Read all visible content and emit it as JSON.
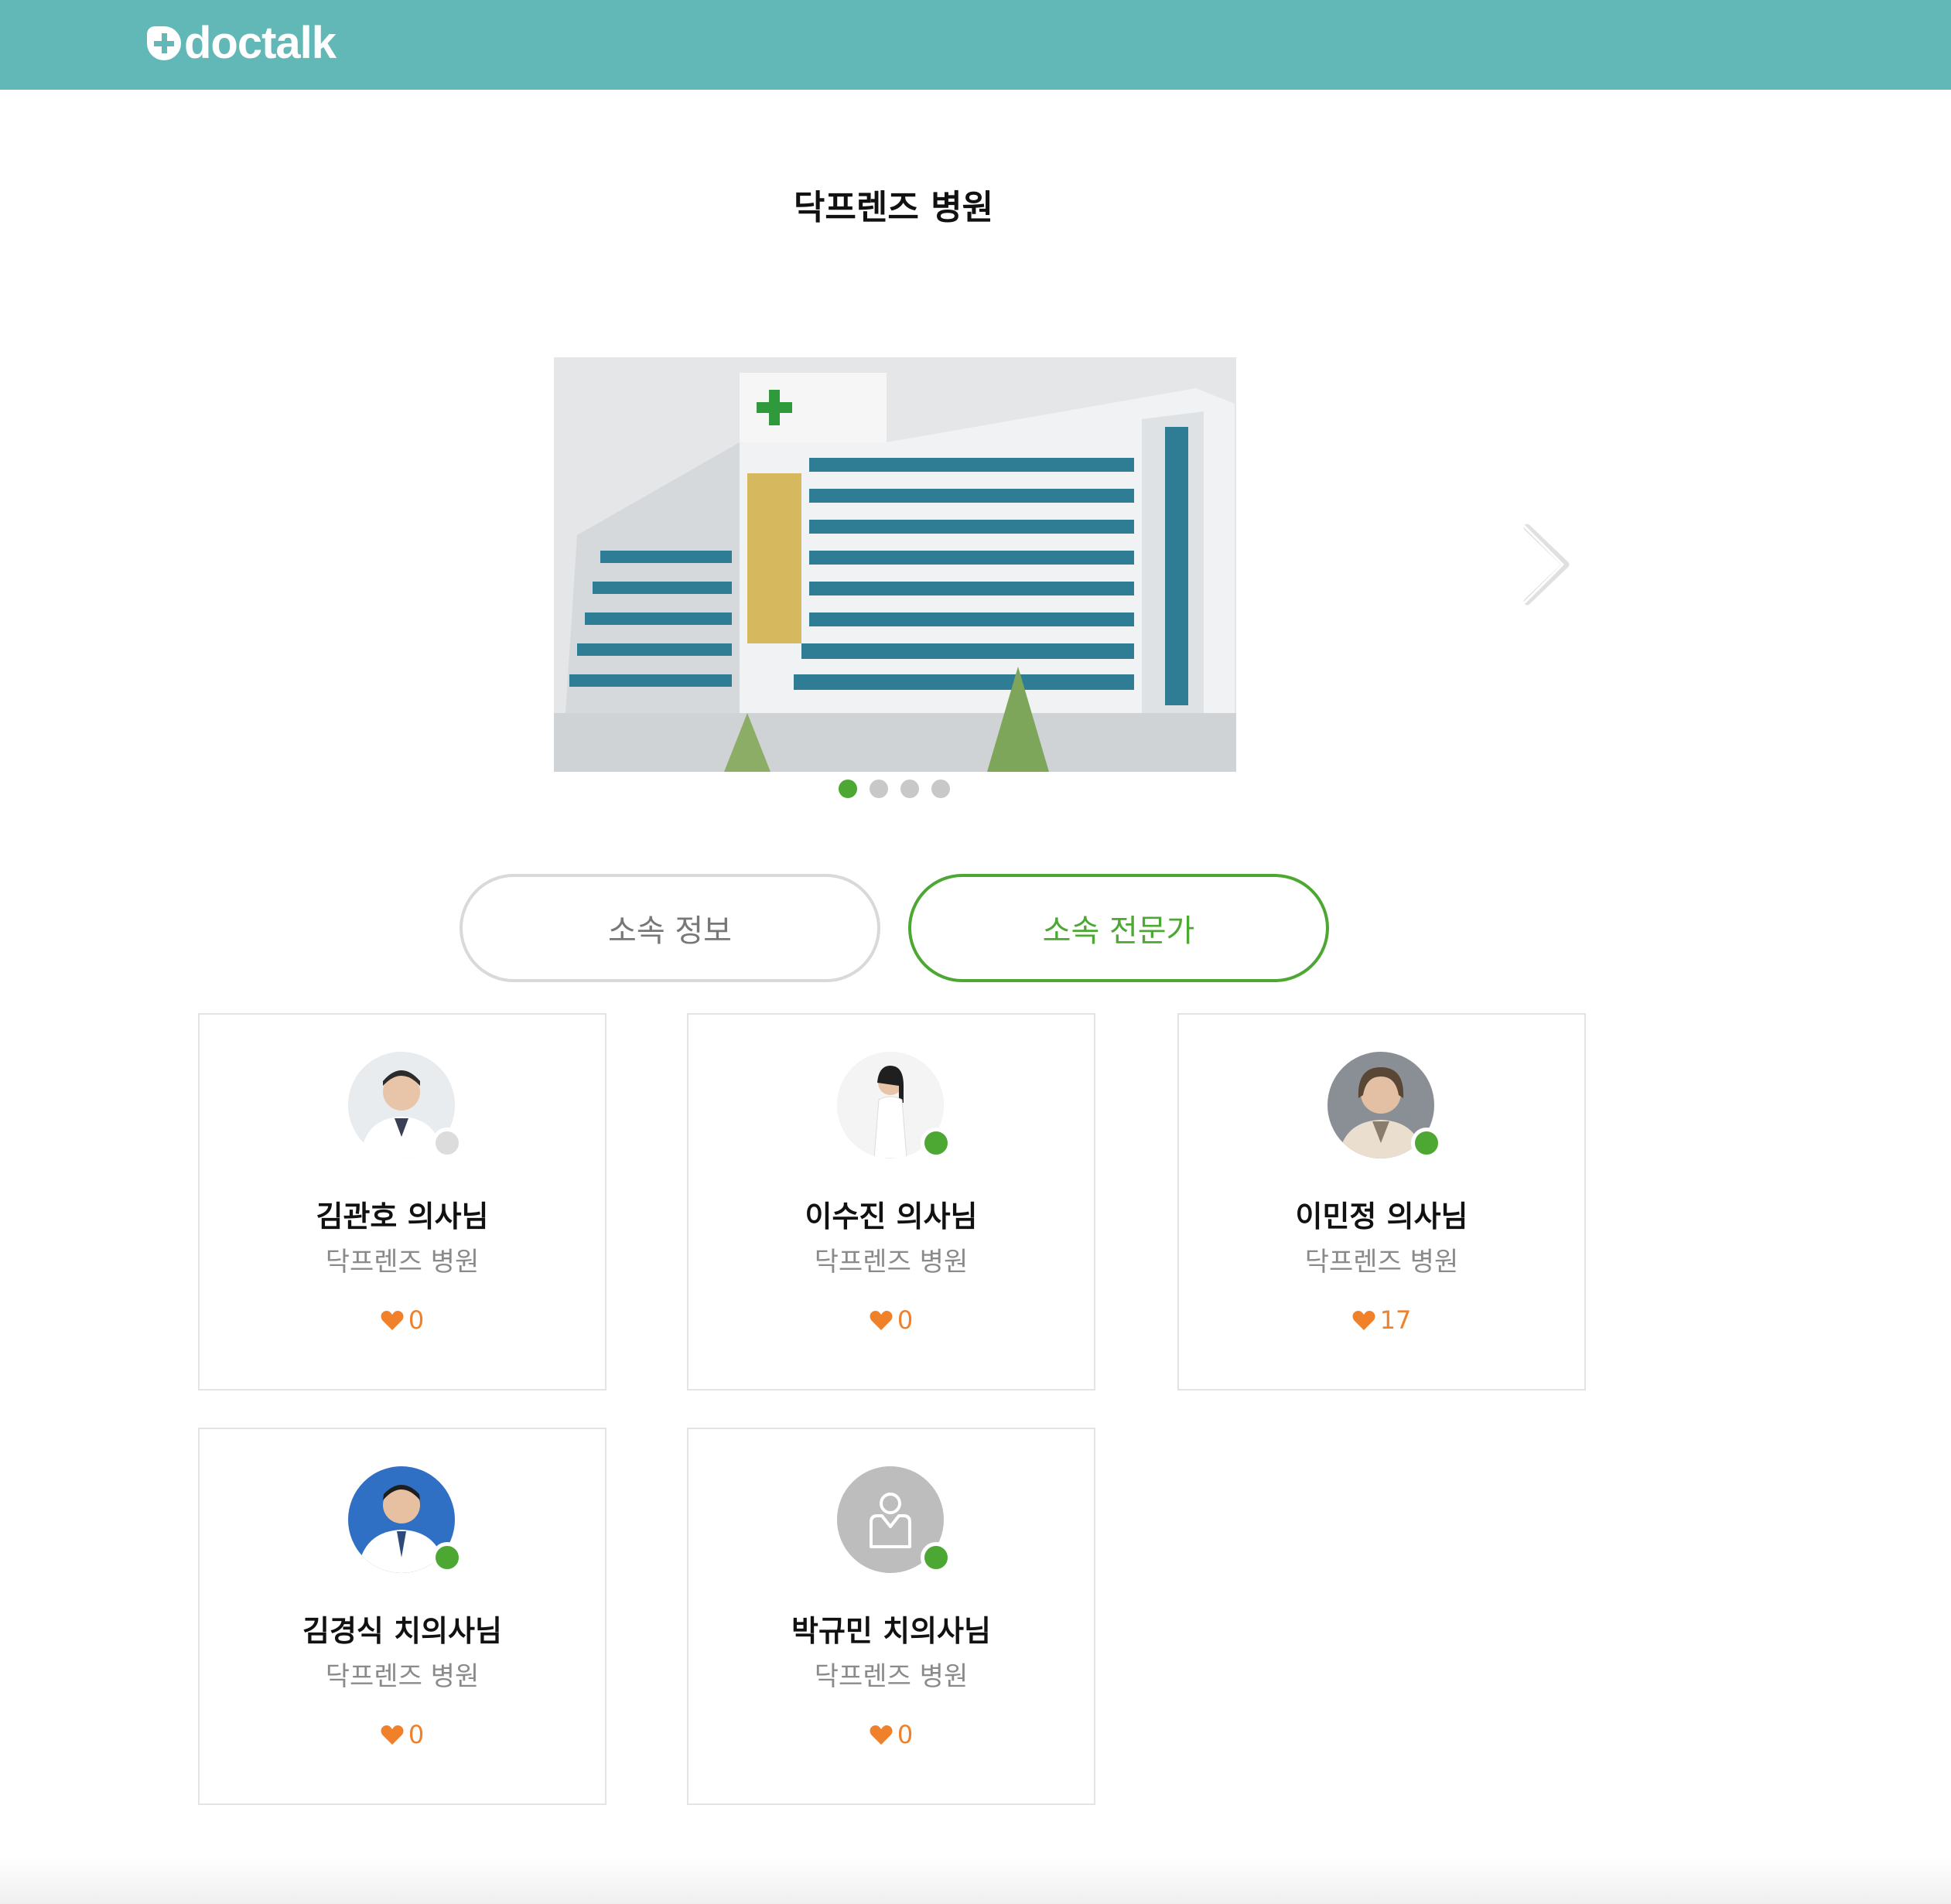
{
  "header": {
    "logo_text": "doctalk",
    "background": "#61b8b6"
  },
  "page": {
    "title": "닥프렌즈 병원"
  },
  "carousel": {
    "slide_count": 4,
    "active_index": 0,
    "active_color": "#4ca832"
  },
  "tabs": [
    {
      "label": "소속 정보",
      "active": false
    },
    {
      "label": "소속 전문가",
      "active": true
    }
  ],
  "experts": [
    {
      "name": "김관호 의사님",
      "hospital": "닥프렌즈 병원",
      "likes": "0",
      "online": false
    },
    {
      "name": "이수진 의사님",
      "hospital": "닥프렌즈 병원",
      "likes": "0",
      "online": true
    },
    {
      "name": "이민정 의사님",
      "hospital": "닥프렌즈 병원",
      "likes": "17",
      "online": true
    },
    {
      "name": "김경식 치의사님",
      "hospital": "닥프렌즈 병원",
      "likes": "0",
      "online": true
    },
    {
      "name": "박규민 치의사님",
      "hospital": "닥프렌즈 병원",
      "likes": "0",
      "online": true
    }
  ],
  "colors": {
    "like": "#f0802a",
    "online": "#4ca832",
    "offline": "#dcdcdc"
  }
}
